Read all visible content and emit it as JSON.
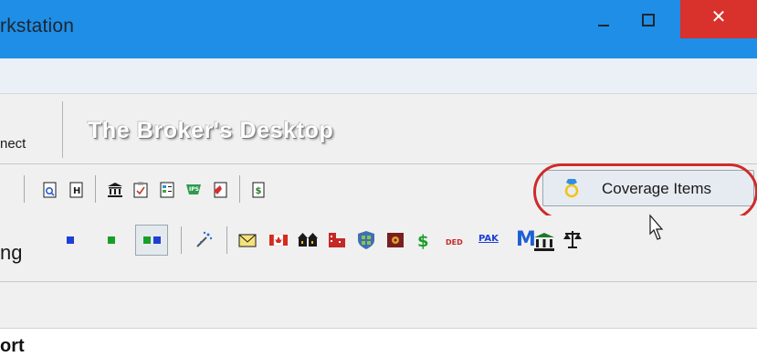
{
  "window": {
    "title": "rkstation",
    "close_glyph": "✕"
  },
  "ribbon": {
    "left_label": "nect",
    "brand_text": "The Broker's Desktop"
  },
  "toolbar1": {
    "coverage_button_label": "Coverage Items",
    "highlight_color": "#cf2b2b"
  },
  "toolbar2": {
    "left_label": "ng",
    "ded_label": "DED",
    "pak_label": "PAK",
    "m_label": "M"
  },
  "footer": {
    "section_label": "ort"
  }
}
